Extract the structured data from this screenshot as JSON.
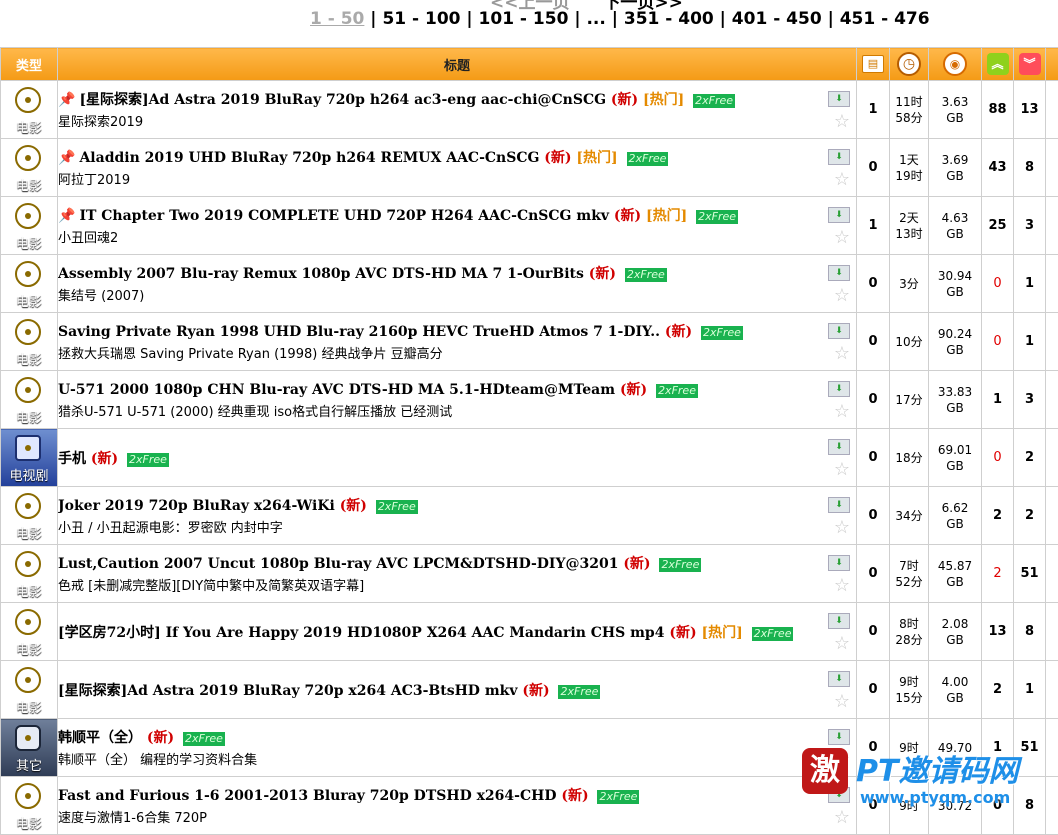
{
  "pager": {
    "prev": "<<上一页",
    "next": "下一页>>",
    "current": "1 - 50",
    "sep": " | ",
    "links": [
      "51 - 100",
      "101 - 150",
      "...",
      "351 - 400",
      "401 - 450",
      "451 - 476"
    ]
  },
  "header": {
    "type": "类型",
    "title": "标题"
  },
  "rows": [
    {
      "cat": "电影",
      "catclass": "movie",
      "pin": true,
      "title": "[星际探索]Ad Astra 2019 BluRay 720p h264 ac3-eng aac-chi@CnSCG",
      "new": "(新)",
      "hot": "[热门]",
      "free": "2xFree",
      "subtitle": "星际探索2019",
      "comments": "1",
      "time1": "11时",
      "time2": "58分",
      "size1": "3.63",
      "size2": "GB",
      "seeders": "88",
      "leechers": "13",
      "seedred": false
    },
    {
      "cat": "电影",
      "catclass": "movie",
      "pin": true,
      "title": "Aladdin 2019 UHD BluRay 720p h264 REMUX AAC-CnSCG",
      "new": "(新)",
      "hot": "[热门]",
      "free": "2xFree",
      "subtitle": "阿拉丁2019",
      "comments": "0",
      "time1": "1天",
      "time2": "19时",
      "size1": "3.69",
      "size2": "GB",
      "seeders": "43",
      "leechers": "8",
      "seedred": false
    },
    {
      "cat": "电影",
      "catclass": "movie",
      "pin": true,
      "title": "IT Chapter Two 2019 COMPLETE UHD 720P H264 AAC-CnSCG mkv",
      "new": "(新)",
      "hot": "[热门]",
      "free": "2xFree",
      "subtitle": "小丑回魂2",
      "comments": "1",
      "time1": "2天",
      "time2": "13时",
      "size1": "4.63",
      "size2": "GB",
      "seeders": "25",
      "leechers": "3",
      "seedred": false
    },
    {
      "cat": "电影",
      "catclass": "movie",
      "pin": false,
      "title": "Assembly 2007 Blu-ray Remux 1080p AVC DTS-HD MA 7 1-OurBits",
      "new": "(新)",
      "hot": "",
      "free": "2xFree",
      "subtitle": "集结号 (2007)",
      "comments": "0",
      "time1": "3分",
      "time2": "",
      "size1": "30.94",
      "size2": "GB",
      "seeders": "0",
      "leechers": "1",
      "seedred": true
    },
    {
      "cat": "电影",
      "catclass": "movie",
      "pin": false,
      "title": "Saving Private Ryan 1998 UHD Blu-ray 2160p HEVC TrueHD Atmos 7 1-DIY..",
      "new": "(新)",
      "hot": "",
      "free": "2xFree",
      "subtitle": "拯救大兵瑞恩 Saving Private Ryan (1998) 经典战争片 豆瓣高分",
      "comments": "0",
      "time1": "10分",
      "time2": "",
      "size1": "90.24",
      "size2": "GB",
      "seeders": "0",
      "leechers": "1",
      "seedred": true
    },
    {
      "cat": "电影",
      "catclass": "movie",
      "pin": false,
      "title": "U-571 2000 1080p CHN Blu-ray AVC DTS-HD MA 5.1-HDteam@MTeam",
      "new": "(新)",
      "hot": "",
      "free": "2xFree",
      "subtitle": "猎杀U-571 U-571 (2000) 经典重现 iso格式自行解压播放 已经测试",
      "comments": "0",
      "time1": "17分",
      "time2": "",
      "size1": "33.83",
      "size2": "GB",
      "seeders": "1",
      "leechers": "3",
      "seedred": false
    },
    {
      "cat": "电视剧",
      "catclass": "tv",
      "pin": false,
      "title": "手机",
      "new": "(新)",
      "hot": "",
      "free": "2xFree",
      "subtitle": "",
      "comments": "0",
      "time1": "18分",
      "time2": "",
      "size1": "69.01",
      "size2": "GB",
      "seeders": "0",
      "leechers": "2",
      "seedred": true
    },
    {
      "cat": "电影",
      "catclass": "movie",
      "pin": false,
      "title": "Joker 2019 720p BluRay x264-WiKi",
      "new": "(新)",
      "hot": "",
      "free": "2xFree",
      "subtitle": "小丑 / 小丑起源电影：罗密欧 内封中字",
      "comments": "0",
      "time1": "34分",
      "time2": "",
      "size1": "6.62",
      "size2": "GB",
      "seeders": "2",
      "leechers": "2",
      "seedred": false
    },
    {
      "cat": "电影",
      "catclass": "movie",
      "pin": false,
      "title": "Lust,Caution 2007 Uncut 1080p Blu-ray AVC LPCM&DTSHD-DIY@3201",
      "new": "(新)",
      "hot": "",
      "free": "2xFree",
      "subtitle": "色戒 [未删减完整版][DIY简中繁中及简繁英双语字幕]",
      "comments": "0",
      "time1": "7时",
      "time2": "52分",
      "size1": "45.87",
      "size2": "GB",
      "seeders": "2",
      "leechers": "51",
      "seedred": true
    },
    {
      "cat": "电影",
      "catclass": "movie",
      "pin": false,
      "title": "[学区房72小时] If You Are Happy 2019 HD1080P X264 AAC Mandarin CHS mp4",
      "new": "(新)",
      "hot": "[热门]",
      "free": "2xFree",
      "subtitle": "",
      "comments": "0",
      "time1": "8时",
      "time2": "28分",
      "size1": "2.08",
      "size2": "GB",
      "seeders": "13",
      "leechers": "8",
      "seedred": false
    },
    {
      "cat": "电影",
      "catclass": "movie",
      "pin": false,
      "title": "[星际探索]Ad Astra 2019 BluRay 720p x264 AC3-BtsHD mkv",
      "new": "(新)",
      "hot": "",
      "free": "2xFree",
      "subtitle": "",
      "comments": "0",
      "time1": "9时",
      "time2": "15分",
      "size1": "4.00",
      "size2": "GB",
      "seeders": "2",
      "leechers": "1",
      "seedred": false
    },
    {
      "cat": "其它",
      "catclass": "other",
      "pin": false,
      "title": "韩顺平（全）",
      "new": "(新)",
      "hot": "",
      "free": "2xFree",
      "subtitle": "韩顺平（全） 编程的学习资料合集",
      "comments": "0",
      "time1": "9时",
      "time2": "",
      "size1": "49.70",
      "size2": "",
      "seeders": "1",
      "leechers": "51",
      "seedred": false
    },
    {
      "cat": "电影",
      "catclass": "movie",
      "pin": false,
      "title": "Fast and Furious 1-6 2001-2013 Bluray 720p DTSHD x264-CHD",
      "new": "(新)",
      "hot": "",
      "free": "2xFree",
      "subtitle": "速度与激情1-6合集 720P",
      "comments": "0",
      "time1": "9时",
      "time2": "",
      "size1": "30.72",
      "size2": "",
      "seeders": "0",
      "leechers": "8",
      "seedred": false
    }
  ],
  "watermark": {
    "logo_char": "激",
    "brand": "PT邀请码网",
    "url": "www.ptyqm.com"
  },
  "icons": {
    "comments": "comment-icon",
    "time": "clock-icon",
    "size": "disk-icon",
    "seeders": "up-arrows-icon",
    "leechers": "down-arrows-icon"
  },
  "colors": {
    "header_bg": "#f49a15",
    "new": "#d00000",
    "hot": "#e48a00",
    "free_bg": "#19b24f"
  }
}
